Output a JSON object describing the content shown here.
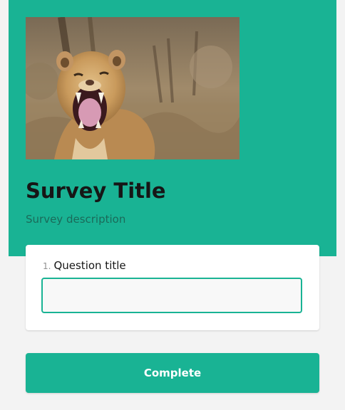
{
  "survey": {
    "title": "Survey Title",
    "description": "Survey description",
    "logo": {
      "icon": "lioness-roaring-photo"
    }
  },
  "question": {
    "number": "1.",
    "title": "Question title",
    "value": ""
  },
  "actions": {
    "complete_label": "Complete"
  },
  "colors": {
    "accent": "#19b394",
    "page_background": "#f3f3f3",
    "card_background": "#ffffff",
    "title_text": "#161616"
  }
}
